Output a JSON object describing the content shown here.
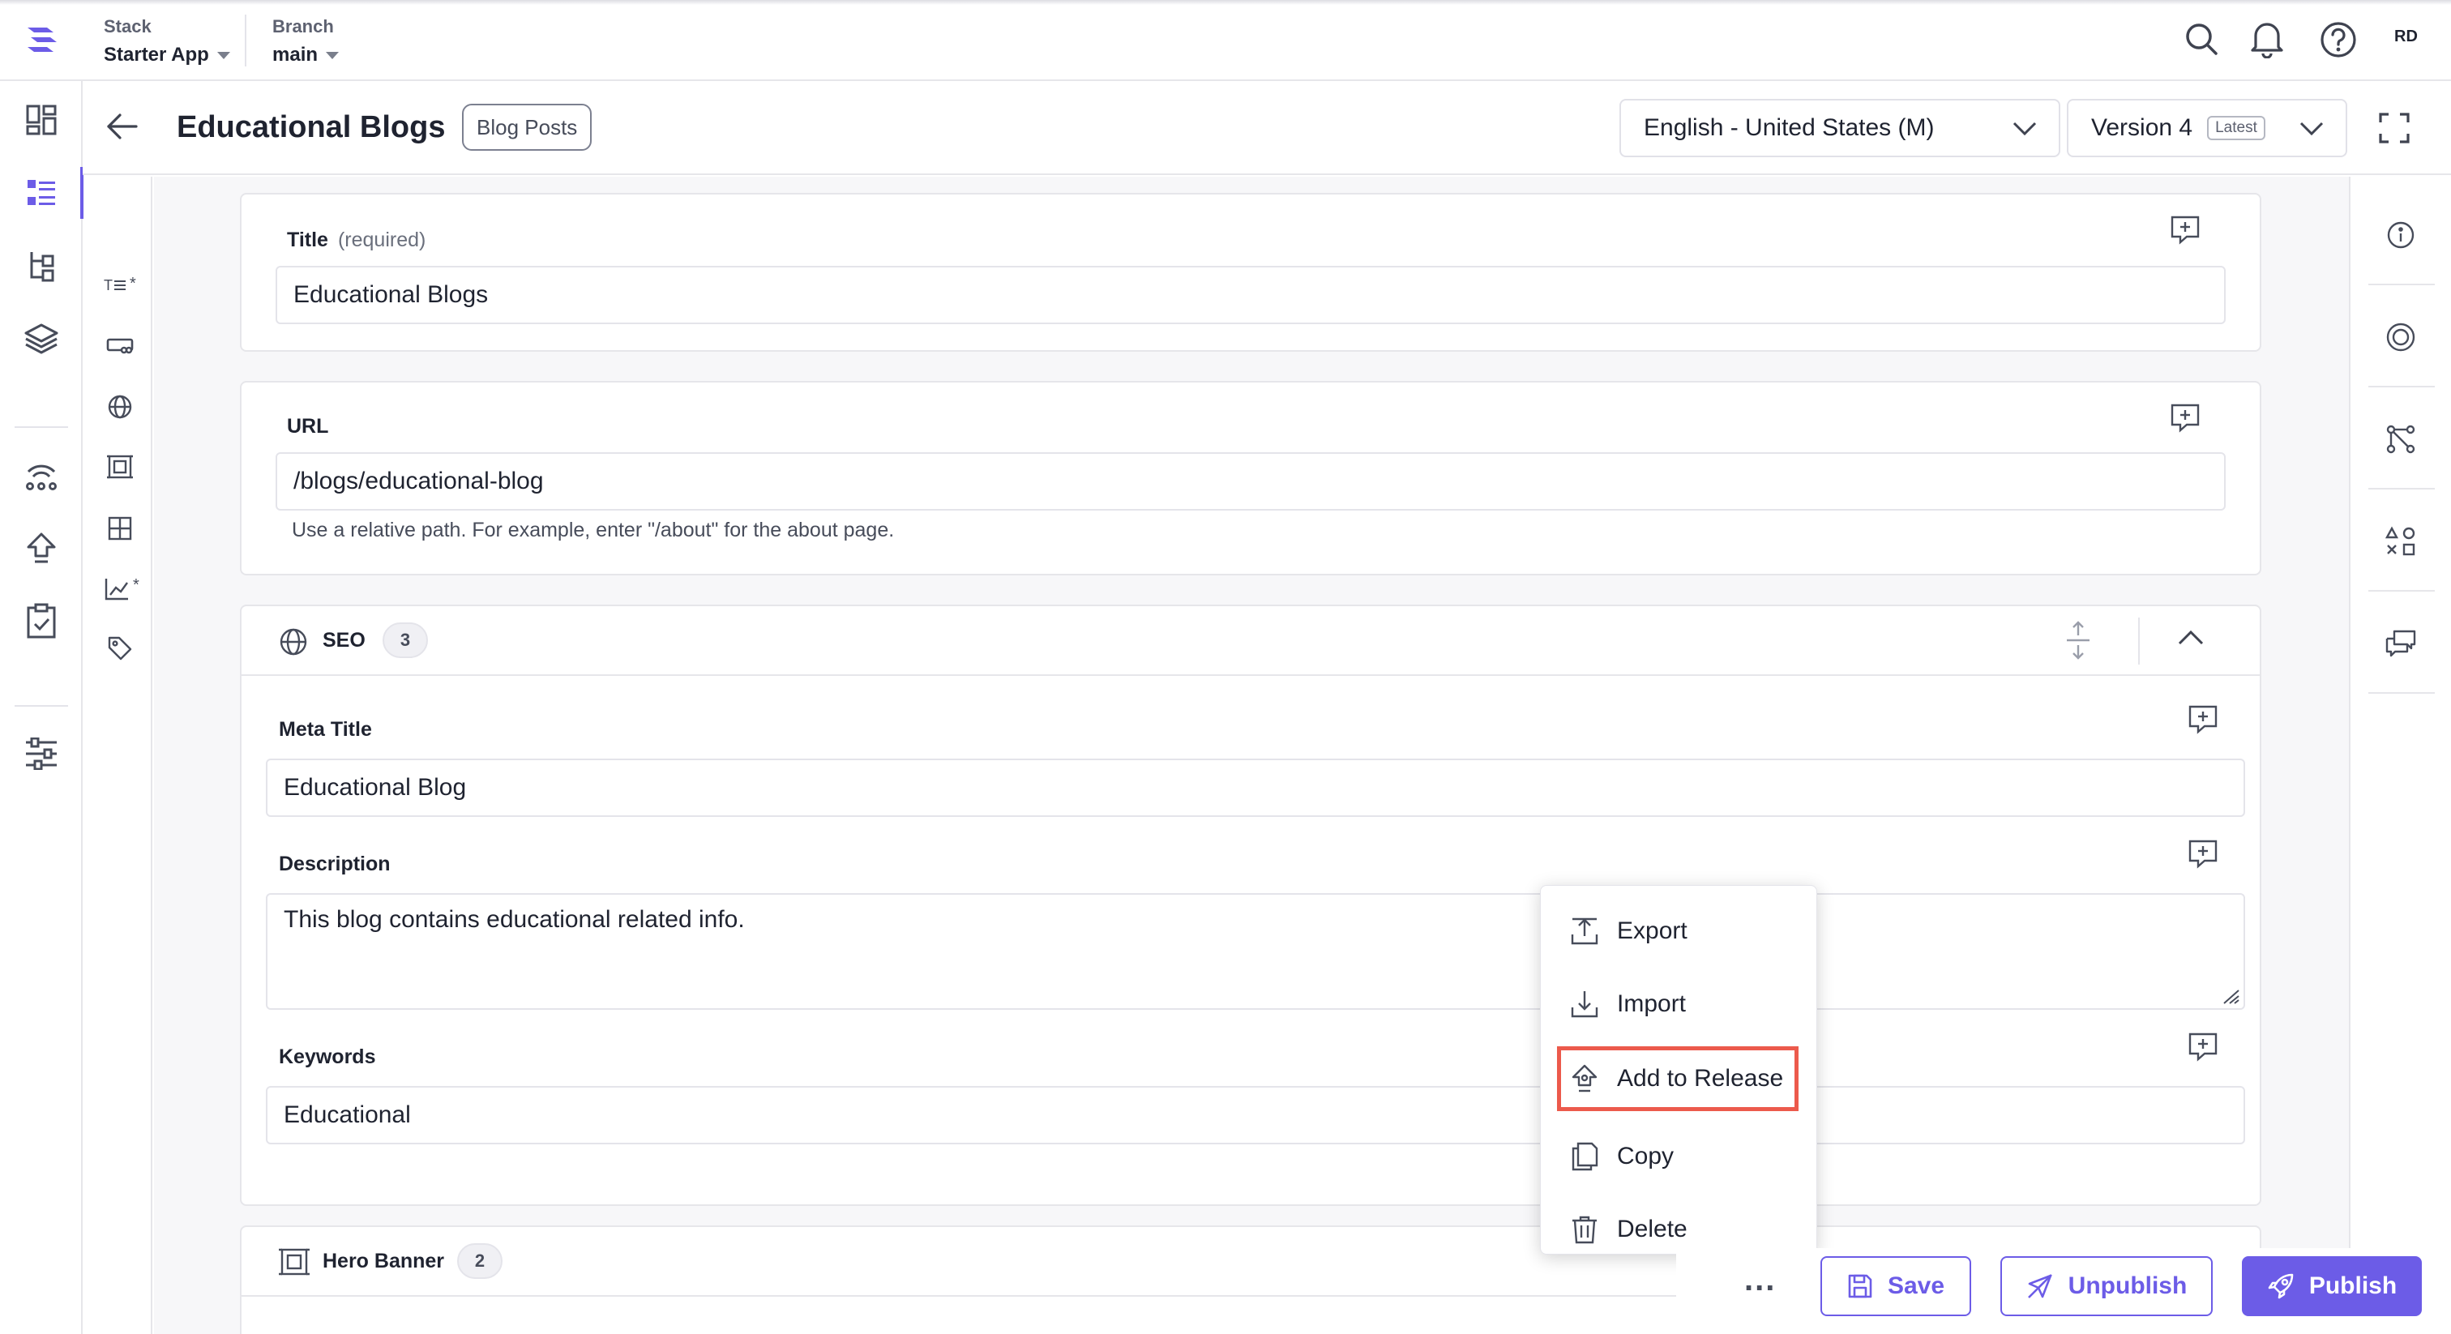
{
  "topbar": {
    "stack_label": "Stack",
    "stack_value": "Starter App",
    "branch_label": "Branch",
    "branch_value": "main",
    "user_initials": "RD"
  },
  "header": {
    "entry_title": "Educational Blogs",
    "content_type": "Blog Posts",
    "locale": "English - United States (M)",
    "version": "Version 4",
    "version_badge": "Latest"
  },
  "fields": {
    "title": {
      "label": "Title",
      "required": "(required)",
      "value": "Educational Blogs"
    },
    "url": {
      "label": "URL",
      "value": "/blogs/educational-blog",
      "help": "Use a relative path. For example, enter \"/about\" for the about page."
    },
    "seo": {
      "label": "SEO",
      "count": "3",
      "meta_title": {
        "label": "Meta Title",
        "value": "Educational Blog"
      },
      "description": {
        "label": "Description",
        "value": "This blog contains educational related info."
      },
      "keywords": {
        "label": "Keywords",
        "value": "Educational"
      }
    },
    "hero_banner": {
      "label": "Hero Banner",
      "count": "2"
    }
  },
  "context_menu": {
    "items": [
      {
        "label": "Export",
        "icon": "export-icon"
      },
      {
        "label": "Import",
        "icon": "import-icon"
      },
      {
        "label": "Add to Release",
        "icon": "release-icon"
      },
      {
        "label": "Copy",
        "icon": "copy-icon"
      },
      {
        "label": "Delete",
        "icon": "trash-icon"
      }
    ]
  },
  "actions": {
    "more": "...",
    "save": "Save",
    "unpublish": "Unpublish",
    "publish": "Publish"
  },
  "colors": {
    "accent": "#6c5ce7",
    "highlight": "#ec5a4c"
  }
}
